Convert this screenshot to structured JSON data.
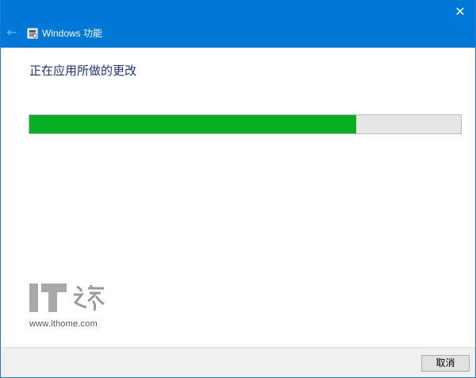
{
  "window": {
    "title": "Windows 功能",
    "close_glyph": "✕",
    "back_glyph": "←",
    "icon": "windows-features-icon"
  },
  "main": {
    "heading": "正在应用所做的更改",
    "progress": {
      "fraction": 0.758,
      "fill_color": "#06b025",
      "track_color": "#e6e6e6"
    }
  },
  "watermark": {
    "logo_text": "IT之家",
    "url": "www.ithome.com"
  },
  "footer": {
    "cancel_label": "取消"
  },
  "colors": {
    "titlebar": "#0078d7",
    "heading_text": "#1e3287"
  }
}
